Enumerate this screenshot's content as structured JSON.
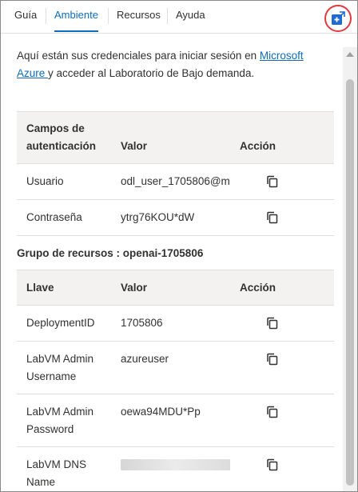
{
  "tabs": [
    {
      "label": "Guía"
    },
    {
      "label": "Ambiente"
    },
    {
      "label": "Recursos"
    },
    {
      "label": "Ayuda"
    }
  ],
  "intro": {
    "before": "Aquí están sus credenciales para iniciar sesión en ",
    "link": "Microsoft Azure ",
    "after": "y acceder al Laboratorio de Bajo demanda."
  },
  "auth_table": {
    "headers": {
      "field": "Campos de autenticación",
      "value": "Valor",
      "action": "Acción"
    },
    "rows": [
      {
        "field": "Usuario",
        "value": "odl_user_1705806@m"
      },
      {
        "field": "Contraseña",
        "value": "ytrg76KOU*dW"
      }
    ]
  },
  "resource_group": {
    "title": "Grupo de recursos : openai-1705806"
  },
  "resource_table": {
    "headers": {
      "key": "Llave",
      "value": "Valor",
      "action": "Acción"
    },
    "rows": [
      {
        "key": "DeploymentID",
        "value": "1705806"
      },
      {
        "key": "LabVM Admin Username",
        "value": "azureuser"
      },
      {
        "key": "LabVM Admin Password",
        "value": "oewa94MDU*Pp"
      },
      {
        "key": "LabVM DNS Name",
        "value": ""
      }
    ]
  },
  "colors": {
    "accent": "#0f6cbd",
    "highlight_ring": "#e0393e",
    "header_bg": "#f3f2f1"
  }
}
